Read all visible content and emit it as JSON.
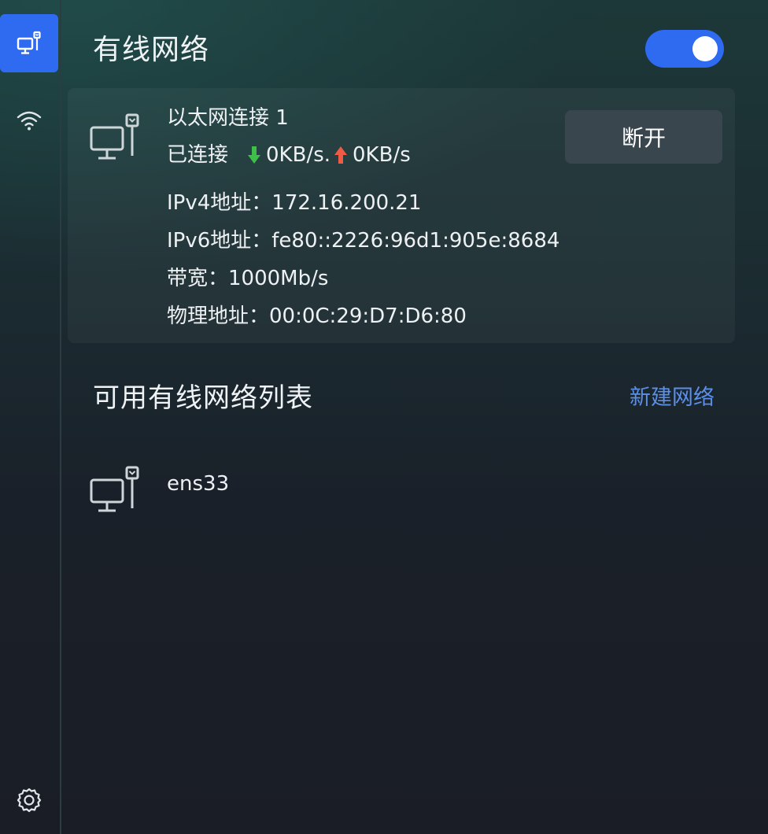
{
  "sidebar": {
    "items": [
      {
        "name": "wired",
        "icon": "wired-network-icon",
        "active": true
      },
      {
        "name": "wireless",
        "icon": "wifi-icon",
        "active": false
      }
    ],
    "settings_icon": "gear-icon"
  },
  "header": {
    "title": "有线网络",
    "toggle_on": true
  },
  "connection": {
    "name": "以太网连接 1",
    "status": "已连接",
    "download": "0KB/s.",
    "upload": "0KB/s",
    "disconnect_label": "断开",
    "details": [
      {
        "label": "IPv4地址：",
        "value": "172.16.200.21"
      },
      {
        "label": "IPv6地址：",
        "value": "fe80::2226:96d1:905e:8684"
      },
      {
        "label": "带宽：",
        "value": "1000Mb/s"
      },
      {
        "label": "物理地址：",
        "value": "00:0C:29:D7:D6:80"
      }
    ]
  },
  "available": {
    "title": "可用有线网络列表",
    "new_network_label": "新建网络",
    "networks": [
      {
        "name": "ens33"
      }
    ]
  },
  "colors": {
    "accent": "#2f6bf0",
    "link": "#5b8fe8",
    "download_arrow": "#3fbf4a",
    "upload_arrow": "#ef5a44"
  }
}
